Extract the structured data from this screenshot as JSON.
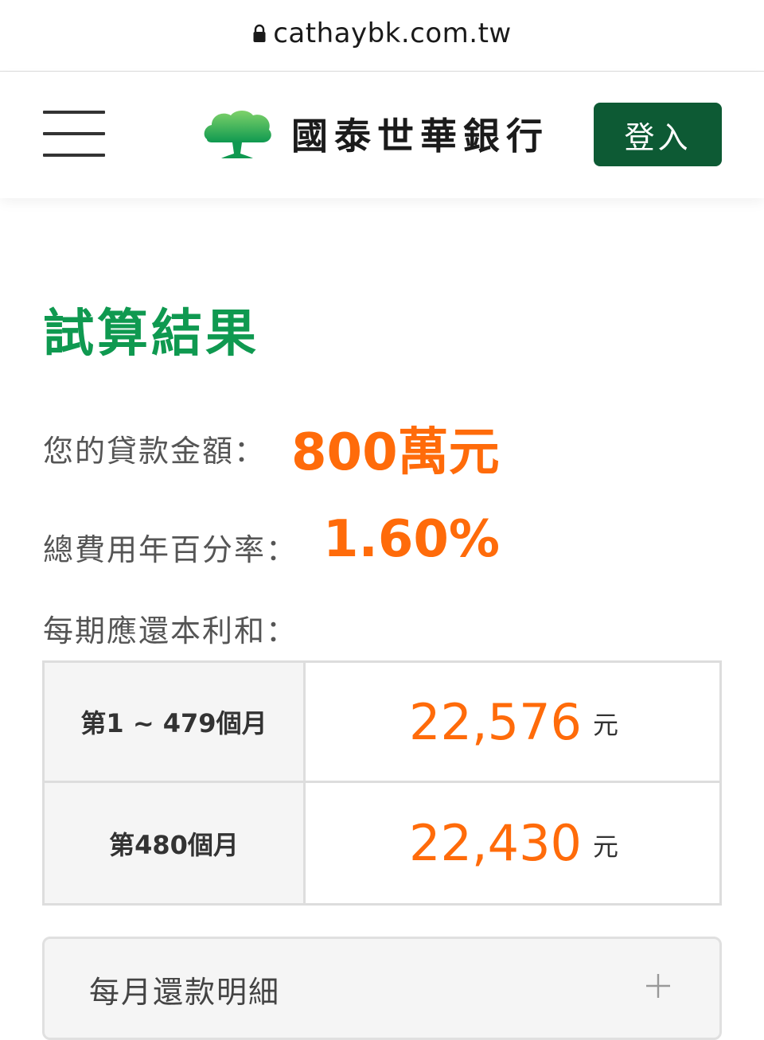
{
  "browser": {
    "url": "cathaybk.com.tw"
  },
  "header": {
    "logo_text": "國泰世華銀行",
    "login_label": "登入",
    "brand_color": "#0f9950",
    "login_bg_color": "#0d5a34"
  },
  "result": {
    "title": "試算結果",
    "loan_amount_label": "您的貸款金額：",
    "loan_amount_value": "800萬元",
    "apr_label": "總費用年百分率：",
    "apr_value": "1.60%",
    "installment_label": "每期應還本利和：",
    "accent_color": "#ff6b0a"
  },
  "payment_table": {
    "rows": [
      {
        "period": "第1 ~ 479個月",
        "amount": "22,576",
        "unit": "元"
      },
      {
        "period": "第480個月",
        "amount": "22,430",
        "unit": "元"
      }
    ]
  },
  "detail": {
    "label": "每月還款明細",
    "icon": "plus-icon"
  }
}
